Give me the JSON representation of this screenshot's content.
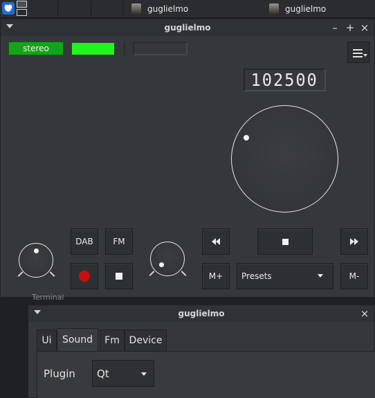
{
  "taskbar": {
    "launcher_icon": "kde-launcher-icon",
    "tasks": [
      {
        "label": "guglielmo",
        "icon": "user-avatar-icon"
      },
      {
        "label": "guglielmo",
        "icon": "user-avatar-icon"
      }
    ]
  },
  "radio_window": {
    "title": "guglielmo",
    "window_controls": {
      "minimize": "–",
      "maximize": "+",
      "close": "×"
    },
    "indicators": {
      "stereo_label": "stereo",
      "stereo_color": "#13a419",
      "signal_color": "#22f51c"
    },
    "menu_icon": "hamburger-menu-icon",
    "frequency": "102500",
    "buttons": {
      "dab": "DAB",
      "fm": "FM",
      "record_icon": "record-icon",
      "stop_icon": "stop-icon",
      "seek_back_icon": "seek-backward-icon",
      "scan_stop_icon": "stop-icon",
      "seek_forward_icon": "seek-forward-icon",
      "memory_add": "M+",
      "memory_remove": "M-",
      "presets": "Presets"
    },
    "knobs": {
      "tuning_dial": "tuning-dial",
      "volume": "volume-knob",
      "gain": "gain-knob"
    }
  },
  "background_label": "Terminal",
  "settings_window": {
    "title": "guglielmo",
    "close": "×",
    "tabs": [
      {
        "label": "Ui",
        "active": false
      },
      {
        "label": "Sound",
        "active": true
      },
      {
        "label": "Fm",
        "active": false
      },
      {
        "label": "Device",
        "active": false
      }
    ],
    "plugin_label": "Plugin",
    "plugin_value": "Qt"
  }
}
